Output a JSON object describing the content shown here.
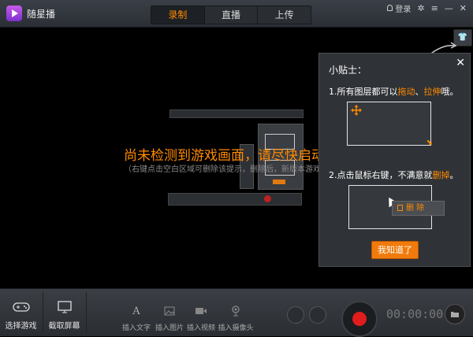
{
  "app": {
    "title": "随星播"
  },
  "tabs": [
    {
      "label": "录制",
      "active": true
    },
    {
      "label": "直播"
    },
    {
      "label": "上传"
    }
  ],
  "topbar": {
    "login_label": "登录"
  },
  "stage": {
    "message": "尚未检测到游戏画面，请尽快启动游戏",
    "sub_message": "（右键点击空白区域可删除该提示，删除后，新版本游戏将会…"
  },
  "tip": {
    "title": "小贴士：",
    "line1_prefix": "1.所有图层都可以",
    "line1_drag": "拖动",
    "line1_sep": "、",
    "line1_stretch": "拉伸",
    "line1_suffix": "哦。",
    "line2_prefix": "2.点击鼠标右键，不满意就",
    "line2_delete": "删掉",
    "line2_suffix": "。",
    "context_delete": "删 除",
    "got_it": "我知道了"
  },
  "bottom": {
    "select_game": "选择游戏",
    "capture_screen": "截取屏幕",
    "insert_text": "插入文字",
    "insert_image": "插入图片",
    "insert_video": "插入视频",
    "insert_camera": "插入摄像头",
    "timer": "00:00:00"
  },
  "colors": {
    "accent": "#ff8a00",
    "record": "#e01d1d"
  }
}
